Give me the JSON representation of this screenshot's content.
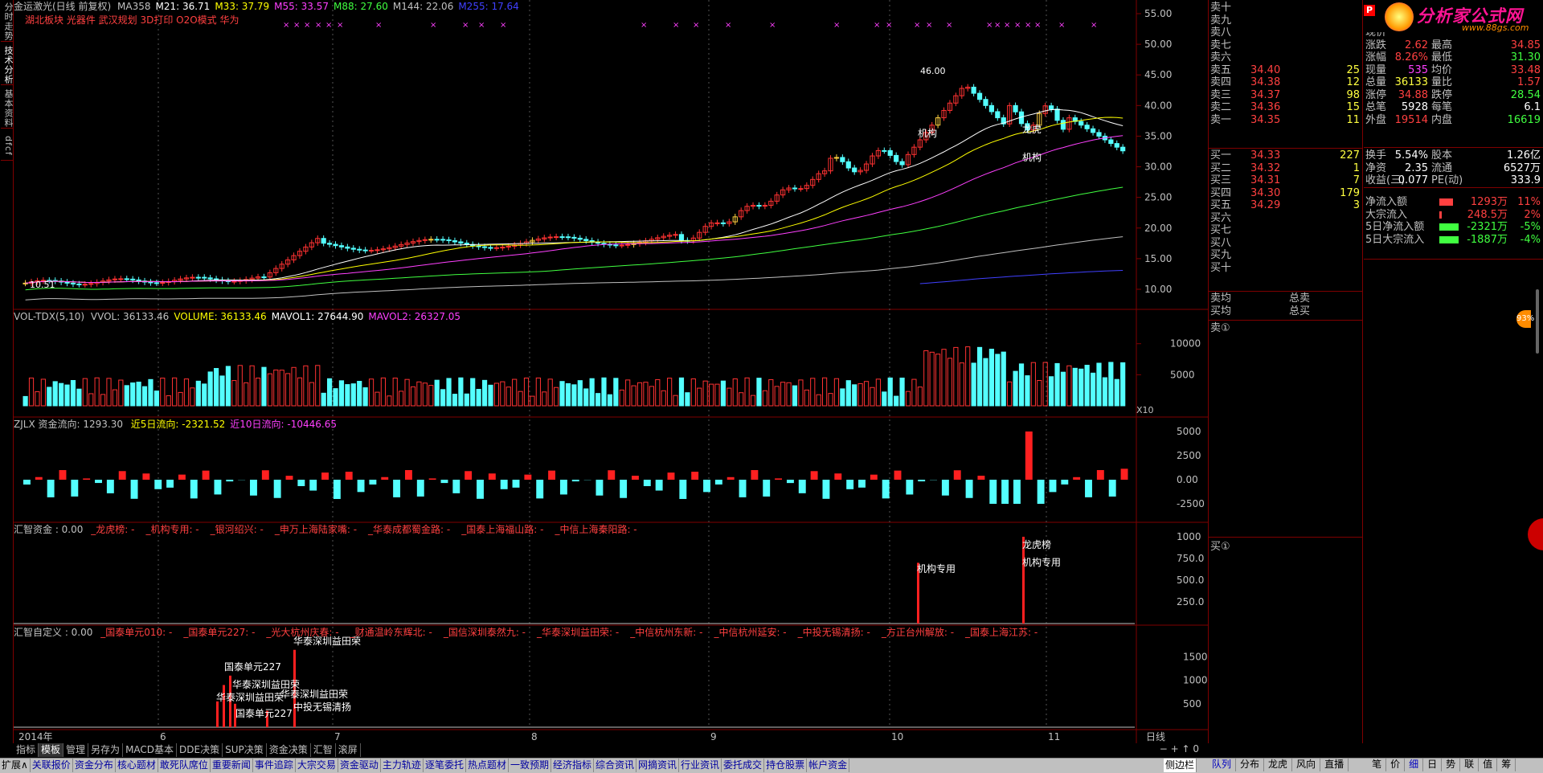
{
  "vertical_tabs": [
    "分时走势",
    "技术分析",
    "基本资料",
    "dfcf"
  ],
  "main_header": {
    "stock": "金运激光(日线 前复权)",
    "ma_items": [
      {
        "label": "MA358",
        "color": "#c0c0c0"
      },
      {
        "label": "M21: 36.71",
        "color": "#ffffff"
      },
      {
        "label": "M33: 37.79",
        "color": "#ffff00"
      },
      {
        "label": "M55: 33.57",
        "color": "#ff40ff"
      },
      {
        "label": "M88: 27.60",
        "color": "#40ff40"
      },
      {
        "label": "M144: 22.06",
        "color": "#c0c0c0"
      },
      {
        "label": "M255: 17.64",
        "color": "#4040ff"
      }
    ],
    "concepts": "湖北板块 光器件 武汉规划 3D打印 O2O模式 华为",
    "high_label": "46.00",
    "low_label": "10.51",
    "annotations": [
      "机构",
      "龙虎",
      "机构"
    ]
  },
  "price_axis": [
    "55.00",
    "50.00",
    "45.00",
    "40.00",
    "35.00",
    "30.00",
    "25.00",
    "20.00",
    "15.00",
    "10.00"
  ],
  "vol_header": {
    "name": "VOL-TDX(5,10)",
    "items": [
      {
        "label": "VVOL: 36133.46",
        "color": "#c0c0c0"
      },
      {
        "label": "VOLUME: 36133.46",
        "color": "#ffff00"
      },
      {
        "label": "MAVOL1: 27644.90",
        "color": "#ffffff"
      },
      {
        "label": "MAVOL2: 26327.05",
        "color": "#ff40ff"
      }
    ]
  },
  "vol_axis": [
    "10000",
    "5000"
  ],
  "vol_unit": "X10",
  "zjlx_header": {
    "name": "ZJLX 资金流向: 1293.30",
    "items": [
      {
        "label": "近5日流向: -2321.52",
        "color": "#ffff00"
      },
      {
        "label": "近10日流向: -10446.65",
        "color": "#ff40ff"
      }
    ]
  },
  "zjlx_axis": [
    "5000",
    "2500",
    "0.00",
    "-2500"
  ],
  "huizhi_header": {
    "name": "汇智资金 : 0.00",
    "items": [
      "_龙虎榜: -",
      "_机构专用: -",
      "_银河绍兴: -",
      "_申万上海陆家嘴: -",
      "_华泰成都蜀金路: -",
      "_国泰上海福山路: -",
      "_中信上海秦阳路: -"
    ]
  },
  "huizhi_axis": [
    "1000",
    "750.0",
    "500.0",
    "250.0"
  ],
  "huizhi_labels": [
    {
      "text": "机构专用"
    },
    {
      "text": "龙虎榜"
    },
    {
      "text": "机构专用"
    }
  ],
  "custom_header": {
    "name": "汇智自定义 : 0.00",
    "items": [
      "_国泰单元010: -",
      "_国泰单元227: -",
      "_光大杭州庆春: -",
      "_财通温岭东辉北: -",
      "_国信深圳泰然九: -",
      "_华泰深圳益田荣: -",
      "_中信杭州东新: -",
      "_中信杭州延安: -",
      "_中投无锡清扬: -",
      "_方正台州解放: -",
      "_国泰上海江苏: -"
    ]
  },
  "custom_axis": [
    "1500",
    "1000",
    "500"
  ],
  "custom_labels": [
    {
      "text": "华泰深圳益田荣"
    },
    {
      "text": "国泰单元227"
    },
    {
      "text": "华泰深圳益田荣"
    },
    {
      "text": "华泰深圳益田荣"
    },
    {
      "text": "华泰深圳益田荣"
    },
    {
      "text": "国泰单元227"
    },
    {
      "text": "中投无锡清扬"
    }
  ],
  "x_axis": {
    "year": "2014年",
    "months": [
      "6",
      "7",
      "8",
      "9",
      "10",
      "11"
    ],
    "period": "日线"
  },
  "bottom_tabs": [
    "指标",
    "模板",
    "管理",
    "另存为",
    "MACD基本",
    "DDE决策",
    "SUP决策",
    "资金决策",
    "汇智",
    "滚屏"
  ],
  "active_bottom_tab": "模板",
  "order_book": {
    "sells": [
      {
        "label": "卖十",
        "price": "",
        "vol": ""
      },
      {
        "label": "卖九",
        "price": "",
        "vol": ""
      },
      {
        "label": "卖八",
        "price": "",
        "vol": ""
      },
      {
        "label": "卖七",
        "price": "",
        "vol": ""
      },
      {
        "label": "卖六",
        "price": "",
        "vol": ""
      },
      {
        "label": "卖五",
        "price": "34.40",
        "vol": "25"
      },
      {
        "label": "卖四",
        "price": "34.38",
        "vol": "12"
      },
      {
        "label": "卖三",
        "price": "34.37",
        "vol": "98"
      },
      {
        "label": "卖二",
        "price": "34.36",
        "vol": "15"
      },
      {
        "label": "卖一",
        "price": "34.35",
        "vol": "11"
      }
    ],
    "buys": [
      {
        "label": "买一",
        "price": "34.33",
        "vol": "227"
      },
      {
        "label": "买二",
        "price": "34.32",
        "vol": "1"
      },
      {
        "label": "买三",
        "price": "34.31",
        "vol": "7"
      },
      {
        "label": "买四",
        "price": "34.30",
        "vol": "179"
      },
      {
        "label": "买五",
        "price": "34.29",
        "vol": "3"
      },
      {
        "label": "买六",
        "price": "",
        "vol": ""
      },
      {
        "label": "买七",
        "price": "",
        "vol": ""
      },
      {
        "label": "买八",
        "price": "",
        "vol": ""
      },
      {
        "label": "买九",
        "price": "",
        "vol": ""
      },
      {
        "label": "买十",
        "price": "",
        "vol": ""
      }
    ],
    "avg_sell": "卖均",
    "avg_buy": "买均",
    "total_sell": "总卖",
    "total_buy": "总买",
    "sell_queue": "卖①",
    "buy_queue": "买①"
  },
  "quote": {
    "logo_text": "分析家公式网",
    "logo_url": "www.88gs.com",
    "rows": [
      {
        "l1": "现价",
        "v1": "",
        "l2": "",
        "v2": "",
        "c1": "#ff4040",
        "c2": "#ff4040"
      },
      {
        "l1": "涨跌",
        "v1": "2.62",
        "l2": "最高",
        "v2": "34.85",
        "c1": "#ff4040",
        "c2": "#ff4040"
      },
      {
        "l1": "涨幅",
        "v1": "8.26%",
        "l2": "最低",
        "v2": "31.30",
        "c1": "#ff4040",
        "c2": "#40ff40"
      },
      {
        "l1": "现量",
        "v1": "535",
        "l2": "均价",
        "v2": "33.48",
        "c1": "#ff40ff",
        "c2": "#ff4040"
      },
      {
        "l1": "总量",
        "v1": "36133",
        "l2": "量比",
        "v2": "1.57",
        "c1": "#ffff40",
        "c2": "#ff4040"
      },
      {
        "l1": "涨停",
        "v1": "34.88",
        "l2": "跌停",
        "v2": "28.54",
        "c1": "#ff4040",
        "c2": "#40ff40"
      },
      {
        "l1": "总笔",
        "v1": "5928",
        "l2": "每笔",
        "v2": "6.1",
        "c1": "#ffffff",
        "c2": "#ffffff"
      },
      {
        "l1": "外盘",
        "v1": "19514",
        "l2": "内盘",
        "v2": "16619",
        "c1": "#ff4040",
        "c2": "#40ff40"
      },
      {
        "l1": "换手",
        "v1": "5.54%",
        "l2": "股本",
        "v2": "1.26亿",
        "c1": "#ffffff",
        "c2": "#ffffff"
      },
      {
        "l1": "净资",
        "v1": "2.35",
        "l2": "流通",
        "v2": "6527万",
        "c1": "#ffffff",
        "c2": "#ffffff"
      },
      {
        "l1": "收益(三)",
        "v1": "0.077",
        "l2": "PE(动)",
        "v2": "333.9",
        "c1": "#ffffff",
        "c2": "#ffffff"
      }
    ],
    "flows": [
      {
        "label": "净流入额",
        "value": "1293万",
        "pct": "11%",
        "color": "#ff4040",
        "ratio": 0.55
      },
      {
        "label": "大宗流入",
        "value": "248.5万",
        "pct": "2%",
        "color": "#ff4040",
        "ratio": 0.1
      },
      {
        "label": "5日净流入额",
        "value": "-2321万",
        "pct": "-5%",
        "color": "#40ff40",
        "ratio": 0.8
      },
      {
        "label": "5日大宗流入",
        "value": "-1887万",
        "pct": "-4%",
        "color": "#40ff40",
        "ratio": 0.8
      }
    ],
    "badge": "93%"
  },
  "func_bar": [
    "扩展∧",
    "关联报价",
    "资金分布",
    "核心题材",
    "敢死队席位",
    "重要新闻",
    "事件追踪",
    "大宗交易",
    "资金驱动",
    "主力轨迹",
    "逐笔委托",
    "热点题材",
    "一致预期",
    "经济指标",
    "综合资讯",
    "网摘资讯",
    "行业资讯",
    "委托成交",
    "持仓股票",
    "帐户资金",
    "侧边栏"
  ],
  "right_tabs": [
    "队列",
    "分布",
    "龙虎",
    "风向",
    "直播",
    "笔",
    "价",
    "细",
    "日",
    "势",
    "联",
    "值",
    "筹"
  ],
  "active_right_tab": "细",
  "colors": {
    "up": "#ff3232",
    "down": "#54ffff",
    "grid": "#7f0000",
    "ma_white": "#ffffff",
    "ma_yellow": "#ffff00",
    "ma_purple": "#ff40ff",
    "ma_green": "#40ff40",
    "ma_gray": "#c0c0c0",
    "ma_blue": "#4040ff"
  }
}
